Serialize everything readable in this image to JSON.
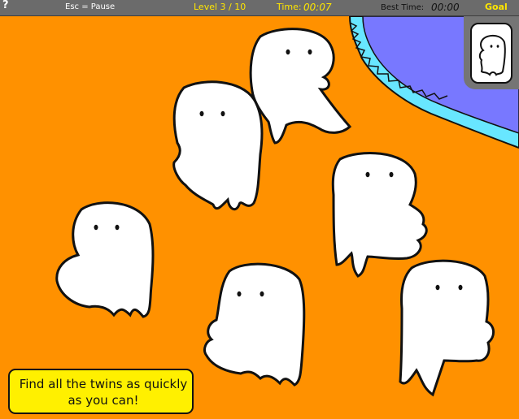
{
  "hud": {
    "help": "?",
    "pause_hint": "Esc = Pause",
    "level": "Level 3 / 10",
    "time_label": "Time:",
    "time_value": "00:07",
    "best_label": "Best Time:",
    "best_value": "00:00",
    "goal_label": "Goal"
  },
  "hint": {
    "text": "Find all the twins as quickly as you can!"
  },
  "colors": {
    "background": "#ff9100",
    "water": "#7878ff",
    "water_edge": "#68e6ff",
    "hud": "#6b6b6b",
    "hint_box": "#fff000"
  },
  "ghosts": [
    {
      "id": "ghost-1",
      "label": "ghost"
    },
    {
      "id": "ghost-2",
      "label": "ghost"
    },
    {
      "id": "ghost-3",
      "label": "ghost"
    },
    {
      "id": "ghost-4",
      "label": "ghost"
    },
    {
      "id": "ghost-5",
      "label": "ghost"
    },
    {
      "id": "ghost-6",
      "label": "ghost"
    }
  ]
}
